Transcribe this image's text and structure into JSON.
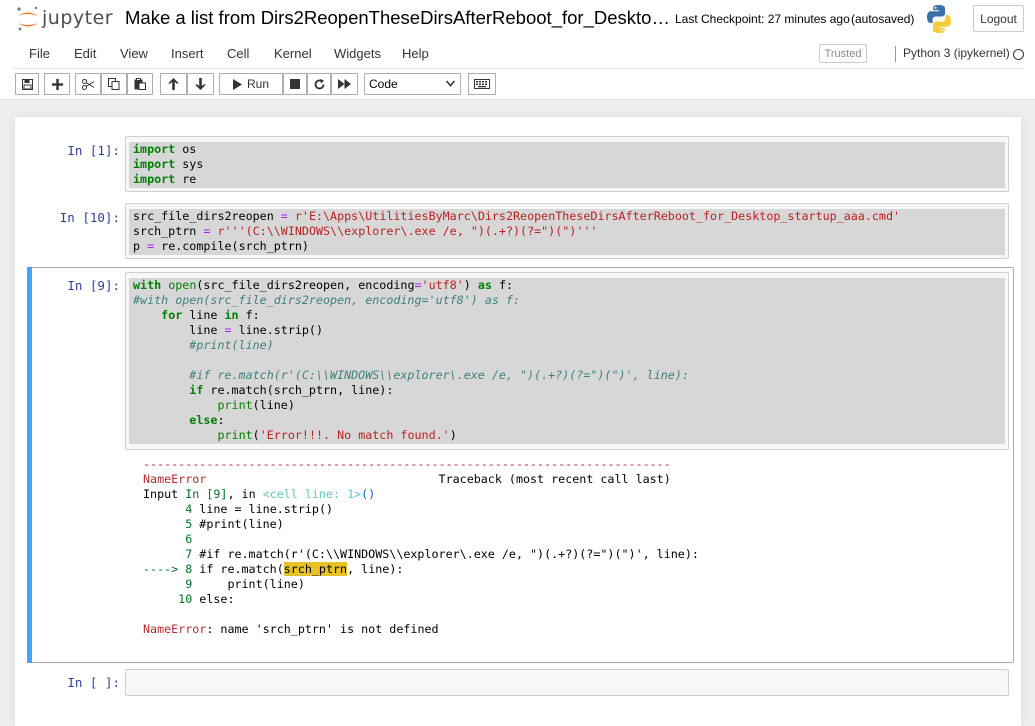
{
  "header": {
    "logo_text": "jupyter",
    "notebook_title": "Make a list from Dirs2ReopenTheseDirsAfterReboot_for_Desktop_sta...",
    "last_checkpoint": "Last Checkpoint: 27 minutes ago",
    "autosave_status": "(autosaved)",
    "logout_label": "Logout"
  },
  "menu": {
    "items": [
      "File",
      "Edit",
      "View",
      "Insert",
      "Cell",
      "Kernel",
      "Widgets",
      "Help"
    ],
    "trusted_label": "Trusted",
    "kernel_name": "Python 3 (ipykernel)"
  },
  "toolbar": {
    "run_label": "Run",
    "cell_type": "Code",
    "buttons": [
      "save-icon",
      "plus-icon",
      "cut-icon",
      "copy-icon",
      "paste-icon",
      "arrow-up-icon",
      "arrow-down-icon",
      "play-icon",
      "stop-icon",
      "restart-icon",
      "fast-forward-icon",
      "keyboard-icon"
    ]
  },
  "cells": {
    "cell1": {
      "prompt": "In [1]:",
      "lines": [
        [
          [
            "kw",
            "import"
          ],
          [
            "",
            " os"
          ]
        ],
        [
          [
            "kw",
            "import"
          ],
          [
            "",
            " sys"
          ]
        ],
        [
          [
            "kw",
            "import"
          ],
          [
            "",
            " re"
          ]
        ]
      ]
    },
    "cell2": {
      "prompt": "In [10]:",
      "lines": [
        [
          [
            "",
            "src_file_dirs2reopen "
          ],
          [
            "op",
            "="
          ],
          [
            "",
            " "
          ],
          [
            "str",
            "r'E:\\Apps\\UtilitiesByMarc\\Dirs2ReopenTheseDirsAfterReboot_for_Desktop_startup_aaa.cmd'"
          ]
        ],
        [
          [
            "",
            "srch_ptrn "
          ],
          [
            "op",
            "="
          ],
          [
            "",
            " "
          ],
          [
            "str",
            "r'''(C:\\\\WINDOWS\\\\explorer\\.exe /e, \")(.+?)(?=\")(\")'''"
          ]
        ],
        [
          [
            "",
            "p "
          ],
          [
            "op",
            "="
          ],
          [
            "",
            " re.compile(srch_ptrn)"
          ]
        ]
      ]
    },
    "cell3": {
      "prompt": "In [9]:",
      "lines": [
        [
          [
            "kw",
            "with"
          ],
          [
            "",
            " "
          ],
          [
            "bi",
            "open"
          ],
          [
            "",
            "(src_file_dirs2reopen, encoding"
          ],
          [
            "op",
            "="
          ],
          [
            "str",
            "'utf8'"
          ],
          [
            "",
            ") "
          ],
          [
            "kw",
            "as"
          ],
          [
            "",
            " f:"
          ]
        ],
        [
          [
            "cm",
            "#with open(src_file_dirs2reopen, encoding='utf8') as f:"
          ]
        ],
        [
          [
            "",
            "    "
          ],
          [
            "kw",
            "for"
          ],
          [
            "",
            " line "
          ],
          [
            "kw",
            "in"
          ],
          [
            "",
            " f:"
          ]
        ],
        [
          [
            "",
            "        line "
          ],
          [
            "op",
            "="
          ],
          [
            "",
            " line.strip()"
          ]
        ],
        [
          [
            "",
            "        "
          ],
          [
            "cm",
            "#print(line)"
          ]
        ],
        [
          [
            "",
            ""
          ]
        ],
        [
          [
            "",
            "        "
          ],
          [
            "cm",
            "#if re.match(r'(C:\\\\WINDOWS\\\\explorer\\.exe /e, \")(.+?)(?=\")(\")', line):"
          ]
        ],
        [
          [
            "",
            "        "
          ],
          [
            "kw",
            "if"
          ],
          [
            "",
            " re.match(srch_ptrn, line):"
          ]
        ],
        [
          [
            "",
            "            "
          ],
          [
            "bi",
            "print"
          ],
          [
            "",
            "(line)"
          ]
        ],
        [
          [
            "",
            "        "
          ],
          [
            "kw",
            "else"
          ],
          [
            "",
            ":"
          ]
        ],
        [
          [
            "",
            "            "
          ],
          [
            "bi",
            "print"
          ],
          [
            "",
            "("
          ],
          [
            "str",
            "'Error!!!. No match found.'"
          ],
          [
            "",
            ")"
          ]
        ]
      ],
      "traceback": [
        [
          [
            "err",
            "---------------------------------------------------------------------------"
          ]
        ],
        [
          [
            "err",
            "NameError"
          ],
          [
            "",
            "                                 Traceback (most recent call last)"
          ]
        ],
        [
          [
            "",
            "Input "
          ],
          [
            "tb-num",
            "In [9]"
          ],
          [
            "",
            ", in "
          ],
          [
            "tb-cyan",
            "<cell line: 1>"
          ],
          [
            "tb-link",
            "()"
          ]
        ],
        [
          [
            "tb-num",
            "      4"
          ],
          [
            "",
            " line "
          ],
          [
            "",
            "="
          ],
          [
            "",
            " line.strip()"
          ]
        ],
        [
          [
            "tb-num",
            "      5"
          ],
          [
            "",
            " #print(line)"
          ]
        ],
        [
          [
            "tb-num",
            "      6"
          ]
        ],
        [
          [
            "tb-num",
            "      7"
          ],
          [
            "",
            " #if re.match(r'(C:\\\\WINDOWS\\\\explorer\\.exe /e, \")(.+?)(?=\")(\")', line):"
          ]
        ],
        [
          [
            "tb-num",
            "----> 8"
          ],
          [
            "",
            " if re.match("
          ],
          [
            "hl",
            "srch_ptrn"
          ],
          [
            "",
            ", line):"
          ]
        ],
        [
          [
            "tb-num",
            "      9"
          ],
          [
            "",
            "     print(line)"
          ]
        ],
        [
          [
            "tb-num",
            "     10"
          ],
          [
            "",
            " else:"
          ]
        ],
        [
          [
            "",
            ""
          ]
        ],
        [
          [
            "err",
            "NameError"
          ],
          [
            "",
            ": name 'srch_ptrn' is not defined"
          ]
        ]
      ]
    },
    "cell4": {
      "prompt": "In [ ]:"
    }
  }
}
